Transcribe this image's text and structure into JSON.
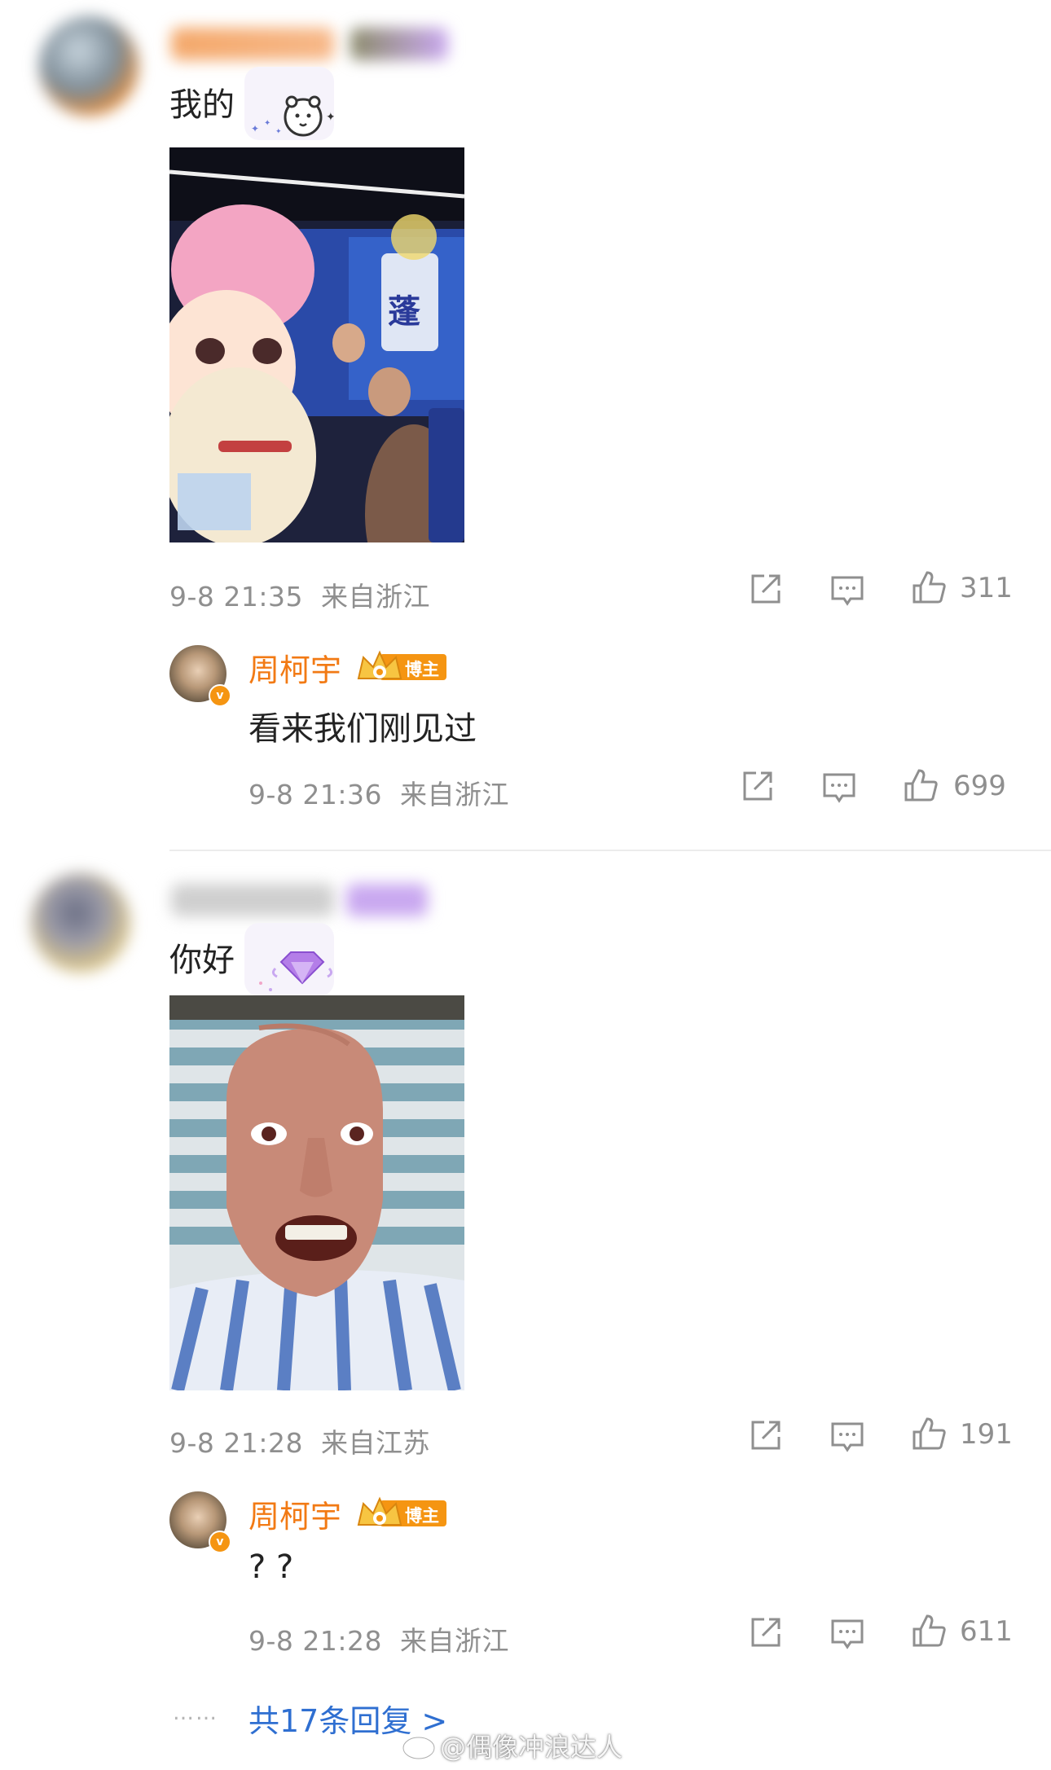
{
  "comments": [
    {
      "text": "我的",
      "meta": "9-8 21:35  来自浙江",
      "likes": "311",
      "reply": {
        "name": "周柯宇",
        "badge": "博主",
        "text": "看来我们刚见过",
        "meta": "9-8 21:36  来自浙江",
        "likes": "699"
      }
    },
    {
      "text": "你好",
      "meta": "9-8 21:28  来自江苏",
      "likes": "191",
      "reply": {
        "name": "周柯宇",
        "badge": "博主",
        "text": "? ?",
        "meta": "9-8 21:28  来自浙江",
        "likes": "611"
      }
    }
  ],
  "more_replies": "共17条回复 >",
  "dots": "……",
  "watermark": "@偶像冲浪达人",
  "colors": {
    "accent_name": "#f27a14",
    "link": "#2f6fd1",
    "meta": "#8f8f8f",
    "verified": "#f59512"
  },
  "icons": [
    "share-icon",
    "comment-icon",
    "like-icon",
    "verified-icon",
    "crown-badge-icon",
    "weibo-icon",
    "bear-sticker-icon",
    "diamond-sticker-icon"
  ]
}
